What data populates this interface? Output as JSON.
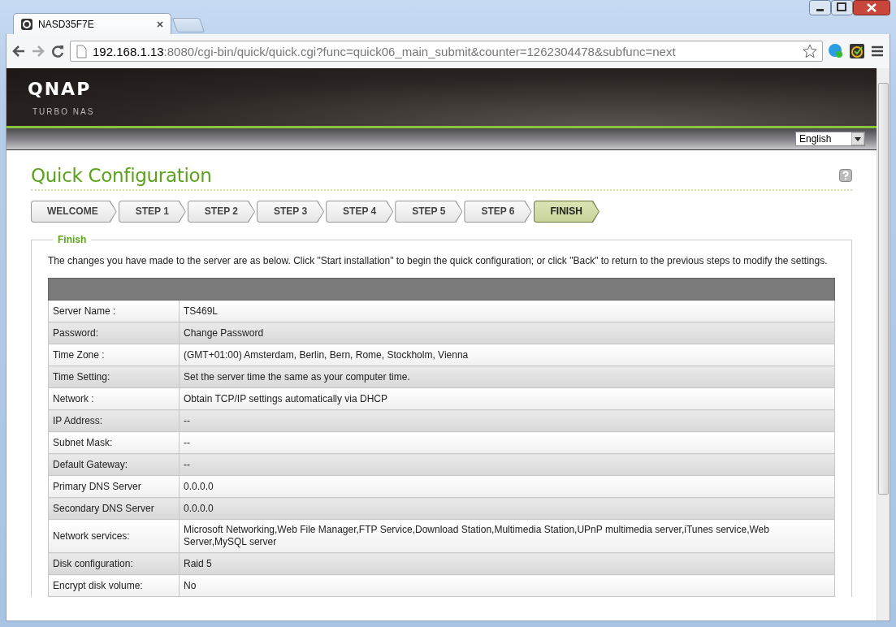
{
  "browser": {
    "tab_title": "NASD35F7E",
    "url_host": "192.168.1.13",
    "url_rest": ":8080/cgi-bin/quick/quick.cgi?func=quick06_main_submit&counter=1262304478&subfunc=next"
  },
  "header": {
    "logo": "QNAP",
    "subtitle": "TURBO NAS",
    "language": "English"
  },
  "page": {
    "title": "Quick Configuration",
    "steps": [
      {
        "label": "WELCOME",
        "selected": false
      },
      {
        "label": "STEP 1",
        "selected": false
      },
      {
        "label": "STEP 2",
        "selected": false
      },
      {
        "label": "STEP 3",
        "selected": false
      },
      {
        "label": "STEP 4",
        "selected": false
      },
      {
        "label": "STEP 5",
        "selected": false
      },
      {
        "label": "STEP 6",
        "selected": false
      },
      {
        "label": "FINISH",
        "selected": true
      }
    ],
    "section": "Finish",
    "intro": "The changes you have made to the server are as below. Click \"Start installation\" to begin the quick configuration; or click \"Back\" to return to the previous steps to modify the settings.",
    "rows": [
      {
        "label": "Server Name :",
        "value": "TS469L"
      },
      {
        "label": "Password:",
        "value": "Change Password"
      },
      {
        "label": "Time Zone :",
        "value": "(GMT+01:00) Amsterdam, Berlin, Bern, Rome, Stockholm, Vienna"
      },
      {
        "label": "Time Setting:",
        "value": "Set the server time the same as your computer time."
      },
      {
        "label": "Network :",
        "value": "Obtain TCP/IP settings automatically via DHCP"
      },
      {
        "label": "IP Address:",
        "value": "--"
      },
      {
        "label": "Subnet Mask:",
        "value": "--"
      },
      {
        "label": "Default Gateway:",
        "value": "--"
      },
      {
        "label": "Primary DNS Server",
        "value": "0.0.0.0"
      },
      {
        "label": "Secondary DNS Server",
        "value": "0.0.0.0"
      },
      {
        "label": "Network services:",
        "value": "Microsoft Networking,Web File Manager,FTP Service,Download Station,Multimedia Station,UPnP multimedia server,iTunes service,Web Server,MySQL server"
      },
      {
        "label": "Disk configuration:",
        "value": "Raid 5"
      },
      {
        "label": "Encrypt disk volume:",
        "value": "No"
      }
    ]
  }
}
